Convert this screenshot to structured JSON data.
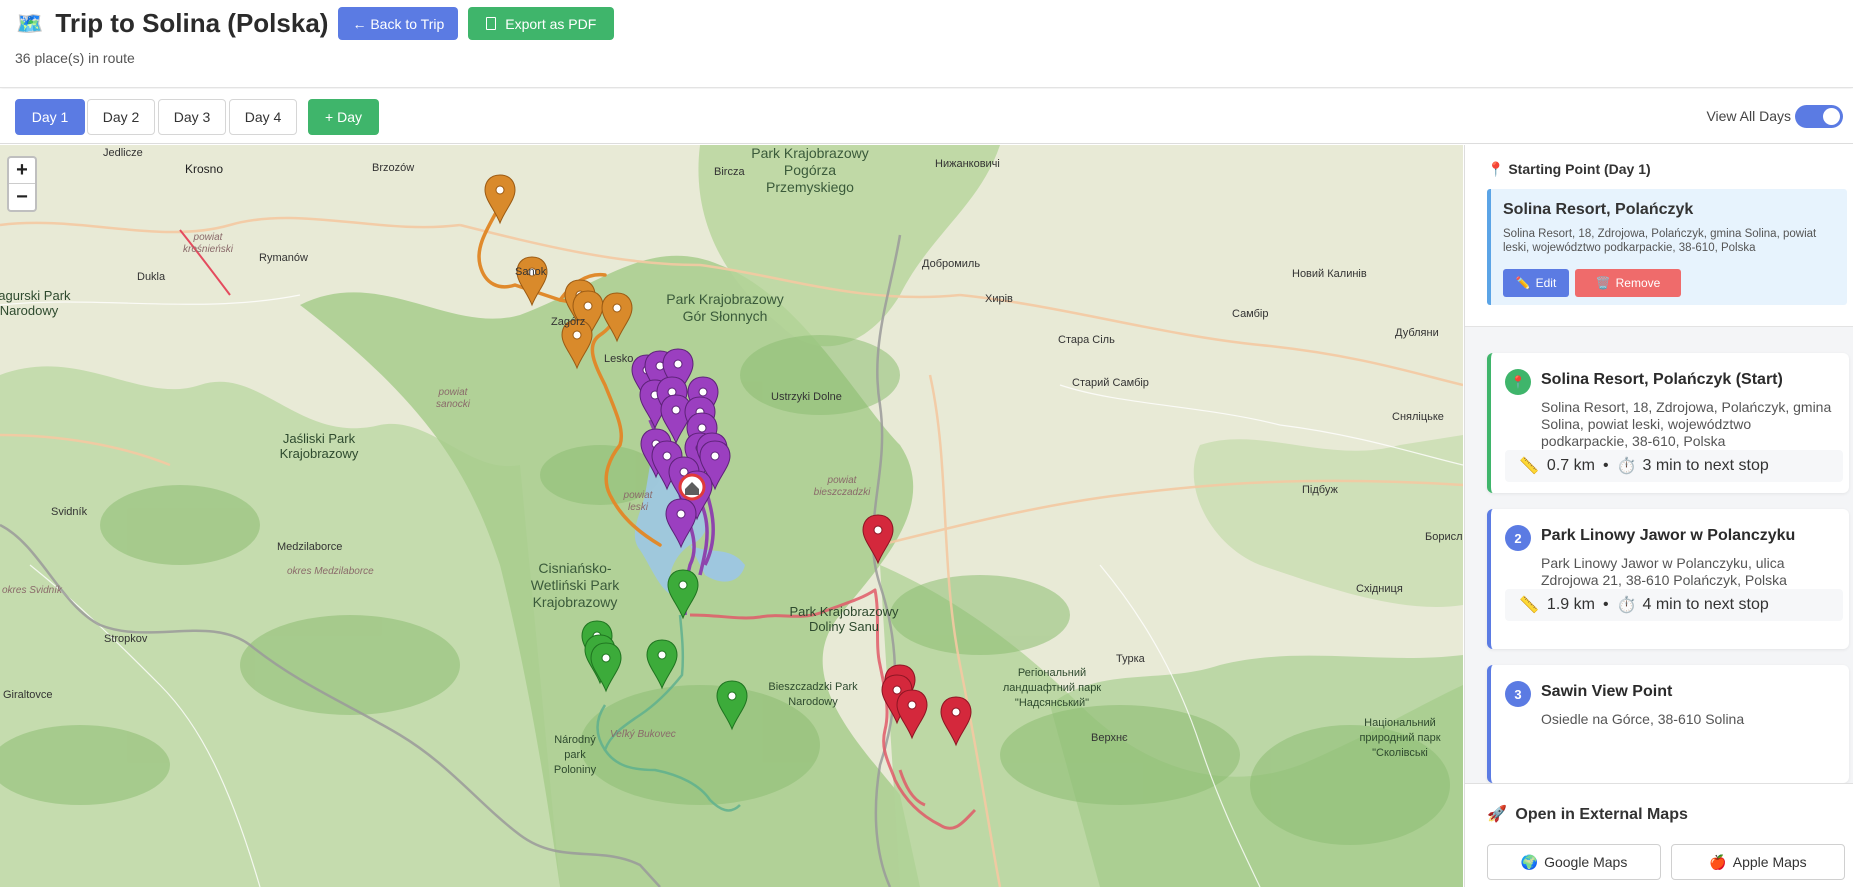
{
  "header": {
    "title_icon": "🗺️",
    "title": "Trip to Solina (Polska)",
    "back_label": "← Back to Trip",
    "export_label": "Export as PDF",
    "subtitle": "36 place(s) in route"
  },
  "tabs": {
    "days": [
      "Day 1",
      "Day 2",
      "Day 3",
      "Day 4"
    ],
    "active_index": 0,
    "add_label": "+ Day",
    "view_all_label": "View All Days",
    "view_all_on": true
  },
  "map": {
    "zoom_in": "+",
    "zoom_out": "−",
    "labels": {
      "krosno": "Krosno",
      "jedlicze": "Jedlicze",
      "brzozow": "Brzozów",
      "bircza": "Bircza",
      "pogorze": "Park Krajobrazowy Pogórza Przemyskiego",
      "nyzhankovychi": "Нижанковичі",
      "krosnienski": "powiat krośnieński",
      "rymanow": "Rymanów",
      "dukla": "Dukla",
      "magurski": "Magurski Park Narodowy",
      "sanok": "Sanok",
      "zagorz": "Zagórz",
      "lesko": "Lesko",
      "gor_slonnych": "Park Krajobrazowy Gór Słonnych",
      "dobromyl": "Добромиль",
      "khyriv": "Хирів",
      "sambir": "Самбір",
      "novyi_kalyniv": "Новий Калинів",
      "dublyany": "Дубляни",
      "stara_sil": "Стара Сіль",
      "staryi_sambir": "Старий Самбір",
      "sanocki": "powiat sanocki",
      "ustrzyki": "Ustrzyki Dolne",
      "jasliski": "Jaśliski Park Krajobrazowy",
      "svyatoslavsk": "Сняліцьке",
      "pidbuzh": "Підбуж",
      "bieszczadzki": "powiat bieszczadzki",
      "leski": "powiat leski",
      "svidnik": "Svidník",
      "medzilaborce": "Medzilaborce",
      "okres_medzilaborce": "okres Medzilaborce",
      "okres_svidnik": "okres Svidník",
      "cisniansko": "Cisniańsko-Wetliński Park Krajobrazowy",
      "stropkov": "Stropkov",
      "doliny_sanu": "Park Krajobrazowy Doliny Sanu",
      "borislav": "Борислав",
      "skhidnytsia": "Східниця",
      "turka": "Турка",
      "nadsianskyi": "Регіональний ландшафтний парк \"Надсянський\"",
      "bieszczadzki_pn": "Bieszczadzki Park Narodowy",
      "giraltovce": "Giraltovce",
      "velky_bukovec": "Veľký Bukovec",
      "narodny_park": "Národný park Poloniny",
      "skolivski": "Національний природний парк \"Сколівські",
      "verkhovyna": "Верхнє"
    }
  },
  "sidebar": {
    "starting_point": {
      "title": "Starting Point (Day 1)",
      "name": "Solina Resort, Polańczyk",
      "address": "Solina Resort, 18, Zdrojowa, Polańczyk, gmina Solina, powiat leski, województwo podkarpackie, 38-610, Polska",
      "edit_label": "Edit",
      "remove_label": "Remove"
    },
    "stops": [
      {
        "marker": "📍",
        "name": "Solina Resort, Polańczyk (Start)",
        "address": "Solina Resort, 18, Zdrojowa, Polańczyk, gmina Solina, powiat leski, województwo podkarpackie, 38-610, Polska",
        "distance": "0.7 km",
        "time": "3 min to next stop"
      },
      {
        "marker": "2",
        "name": "Park Linowy Jawor w Polanczyku",
        "address": "Park Linowy Jawor w Polanczyku, ulica Zdrojowa 21, 38-610 Polańczyk, Polska",
        "distance": "1.9 km",
        "time": "4 min to next stop"
      },
      {
        "marker": "3",
        "name": "Sawin View Point",
        "address": "Osiedle na Górce, 38-610 Solina",
        "distance": "",
        "time": ""
      }
    ],
    "external": {
      "title": "Open in External Maps",
      "google_label": "Google Maps",
      "apple_label": "Apple Maps"
    }
  },
  "colors": {
    "primary": "#5b7be3",
    "success": "#3fb56b",
    "danger": "#ef6b6b",
    "day1_route": "#8e44ad",
    "day2_route": "#e08a2c",
    "day3_route": "#3aa84a",
    "day4_route": "#cc2b3c"
  }
}
